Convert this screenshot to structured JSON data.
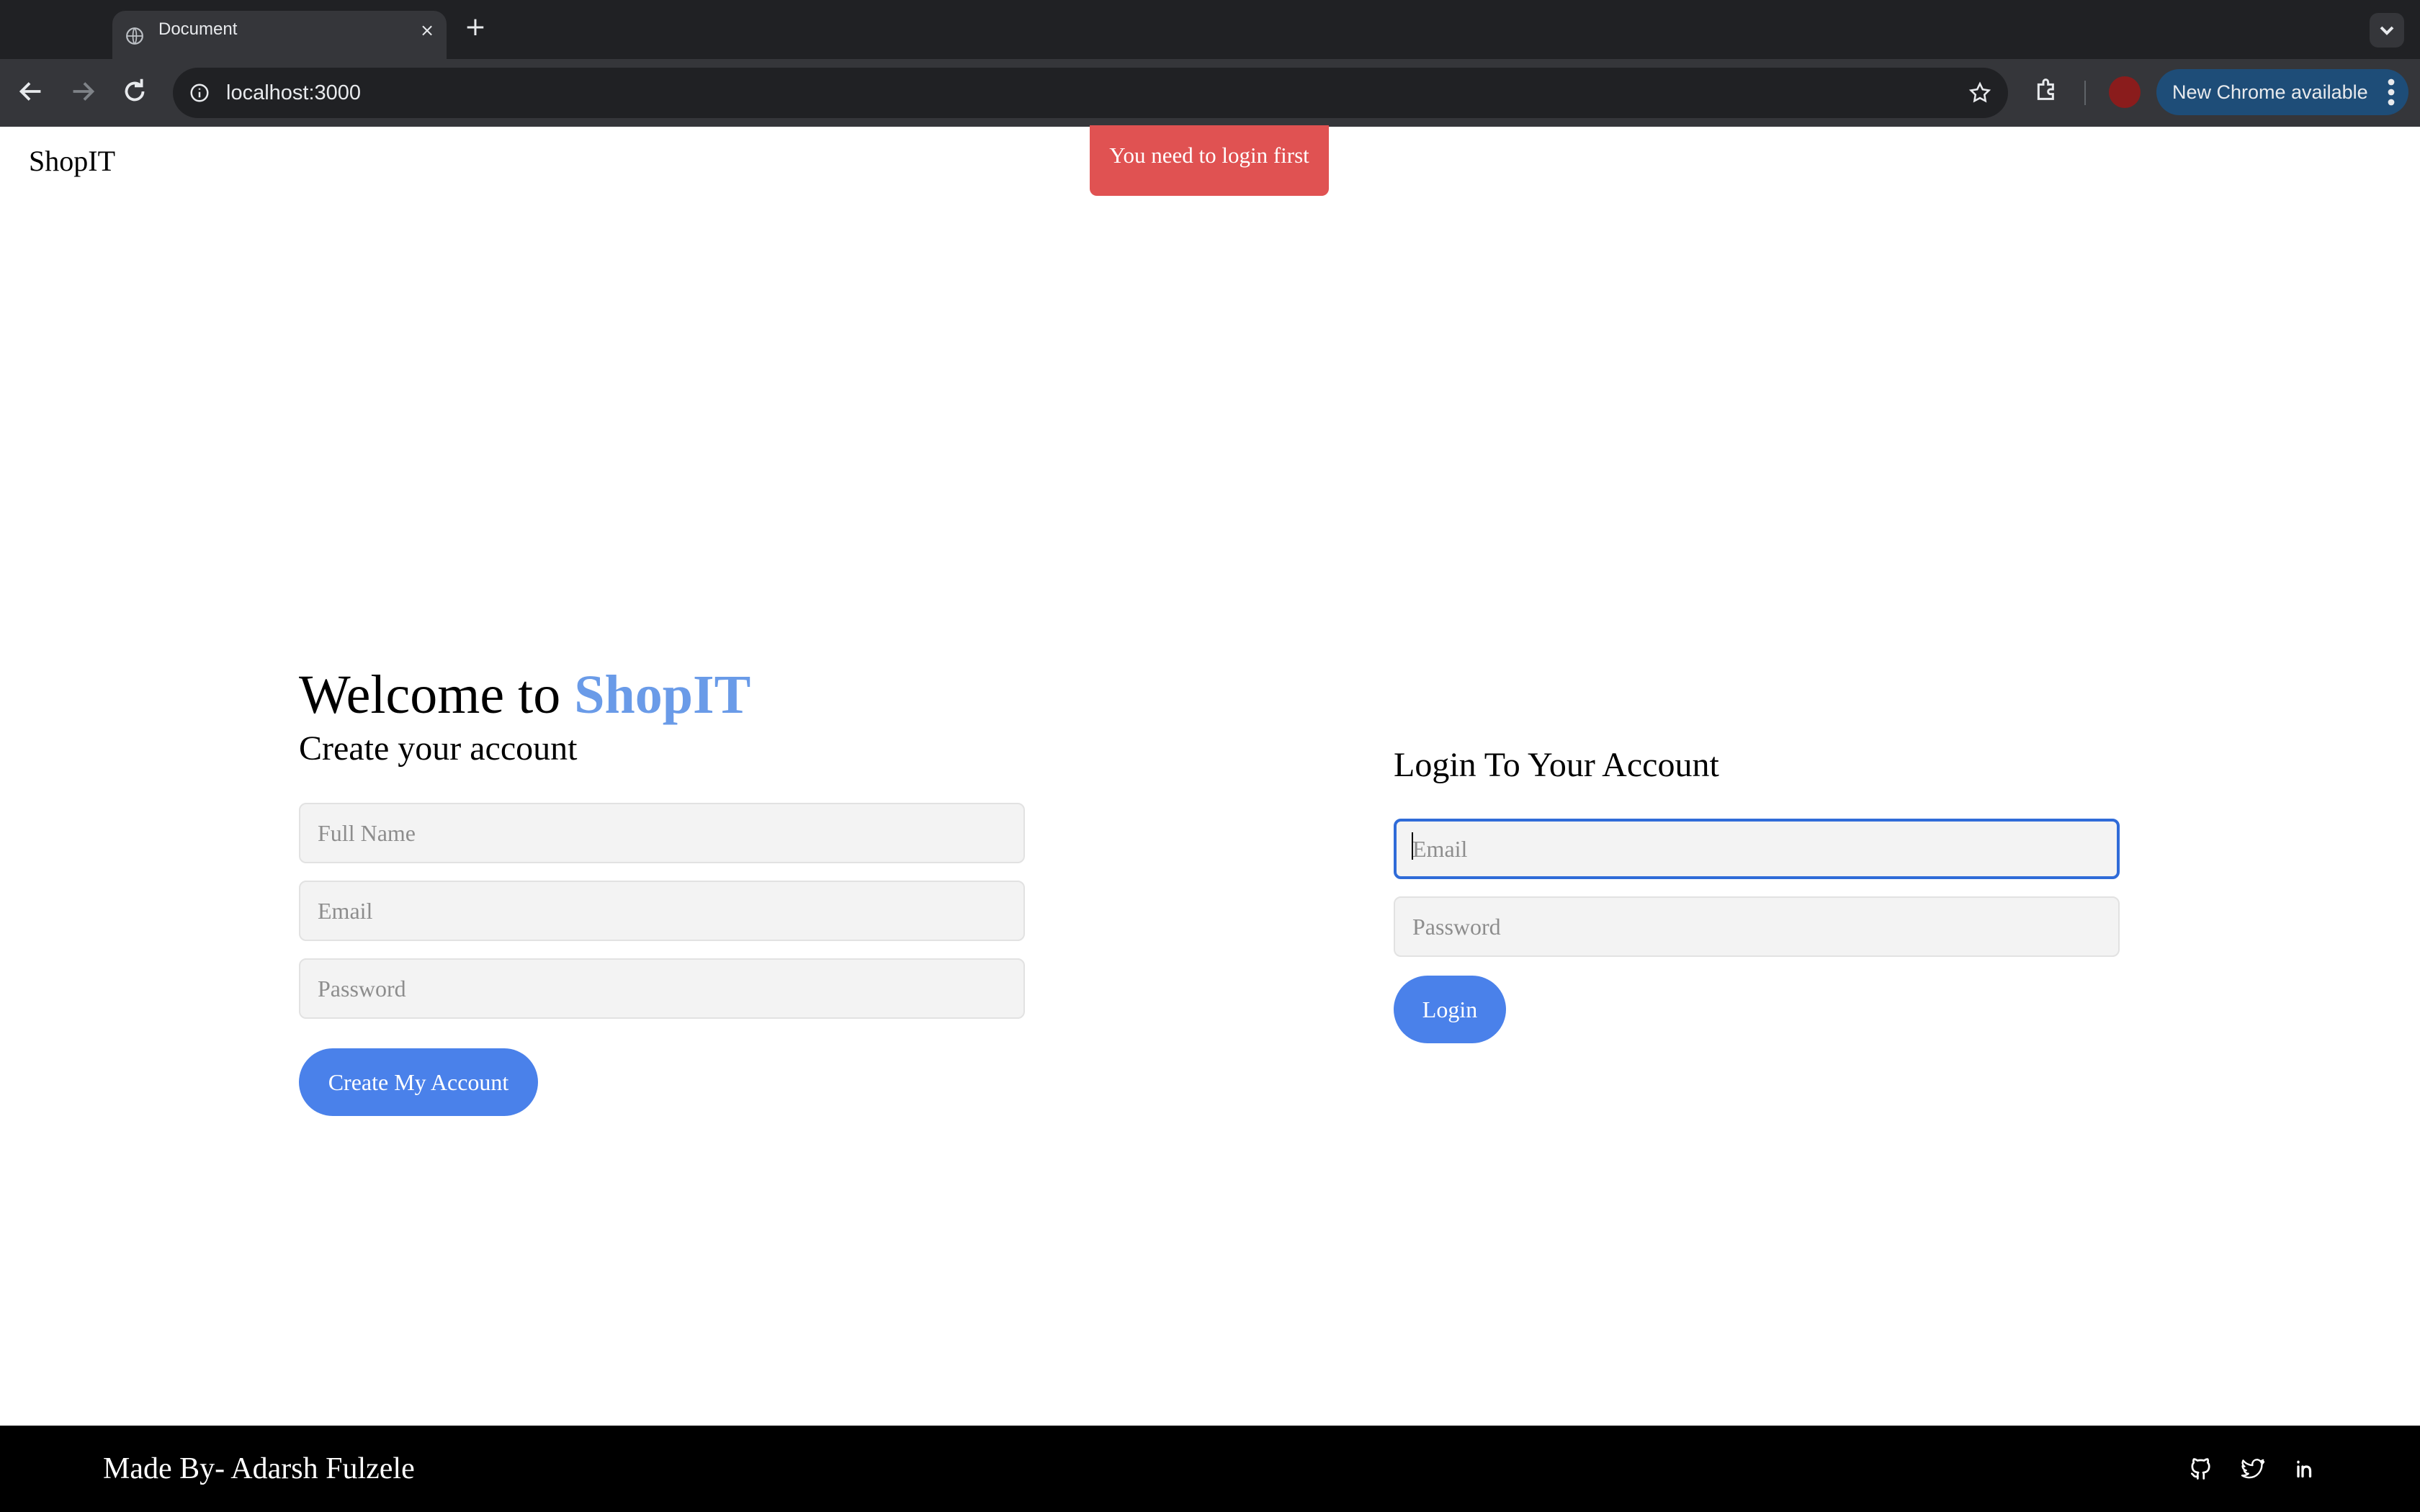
{
  "browser": {
    "tab_title": "Document",
    "tab_close": "×",
    "new_tab": "+",
    "url": "localhost:3000",
    "update_label": "New Chrome available"
  },
  "page": {
    "brand": "ShopIT",
    "toast": "You need to login first",
    "welcome_prefix": "Welcome to",
    "welcome_brand": "ShopIT",
    "accent_color": "#6a9be8",
    "button_color": "#4a81ea",
    "toast_color": "#e05252"
  },
  "register": {
    "title": "Create your account",
    "fullname_placeholder": "Full Name",
    "email_placeholder": "Email",
    "password_placeholder": "Password",
    "submit_label": "Create My Account"
  },
  "login": {
    "title": "Login To Your Account",
    "email_placeholder": "Email",
    "password_placeholder": "Password",
    "submit_label": "Login"
  },
  "footer": {
    "credit": "Made By- Adarsh Fulzele",
    "social_icons": [
      "github-icon",
      "twitter-icon",
      "linkedin-icon"
    ]
  }
}
